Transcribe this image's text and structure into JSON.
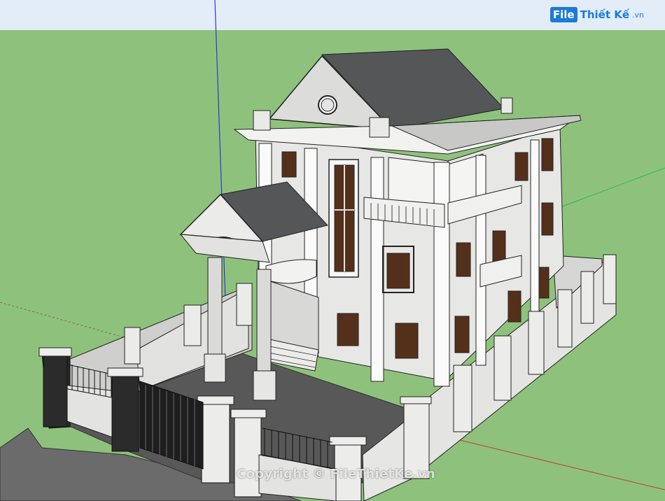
{
  "viewport": {
    "sky_color": "#e3edf8",
    "ground_color": "#8ec27c",
    "axes": {
      "blue": "#2c38d8",
      "green": "#2fb84a",
      "red": "#c43c2c"
    }
  },
  "logo": {
    "badge": "File",
    "name": "Thiết Kế",
    "suffix": ".vn"
  },
  "watermark": "Copyright © FileThietKe.vn",
  "model": {
    "wall_color": "#e7e7e5",
    "roof_color": "#555657",
    "floor_color": "#585858",
    "window_color": "#54301a"
  }
}
